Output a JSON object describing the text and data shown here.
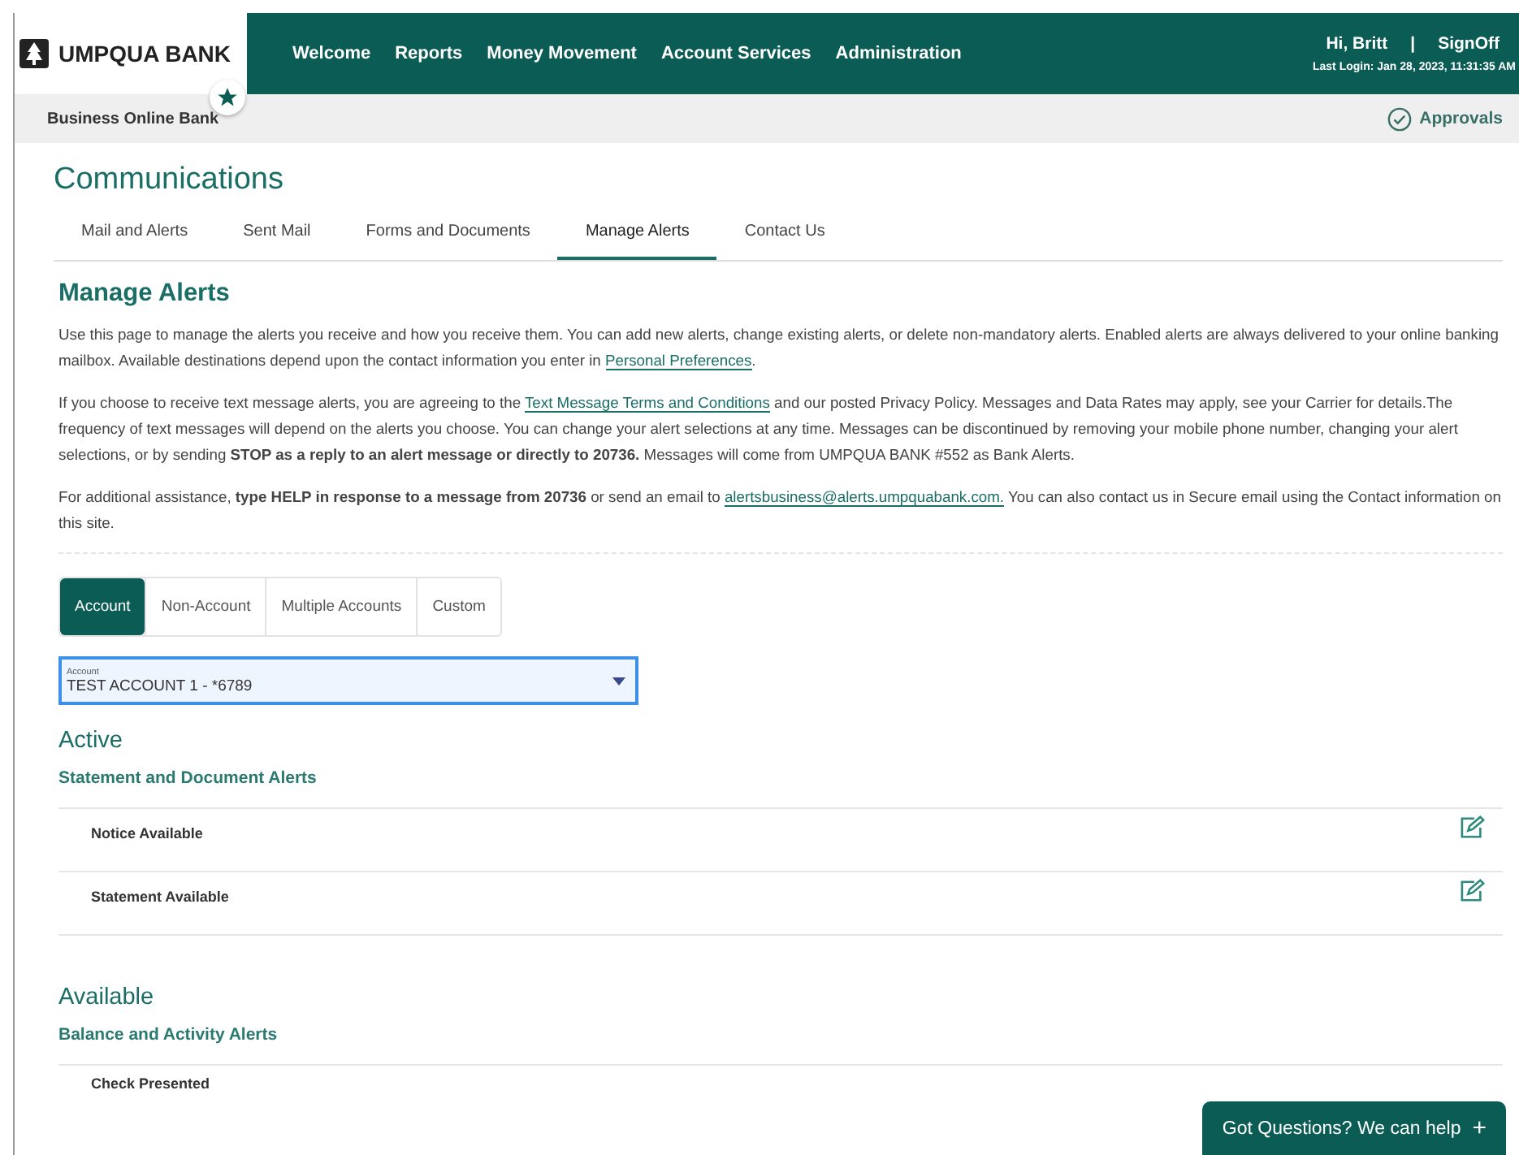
{
  "header": {
    "logo": "UMPQUA BANK",
    "nav": [
      "Welcome",
      "Reports",
      "Money Movement",
      "Account Services",
      "Administration"
    ],
    "greeting": "Hi, Britt",
    "separator": "|",
    "signoff": "SignOff",
    "last_login": "Last Login: Jan 28, 2023, 11:31:35 AM"
  },
  "subheader": {
    "title": "Business Online Bank",
    "approvals": "Approvals"
  },
  "page_title": "Communications",
  "tabs": [
    {
      "label": "Mail and Alerts",
      "selected": false
    },
    {
      "label": "Sent Mail",
      "selected": false
    },
    {
      "label": "Forms and Documents",
      "selected": false
    },
    {
      "label": "Manage Alerts",
      "selected": true
    },
    {
      "label": "Contact Us",
      "selected": false
    }
  ],
  "section_title": "Manage Alerts",
  "paragraphs": [
    [
      {
        "kind": "text",
        "text": "Use this page to manage the alerts you receive and how you receive them. You can add new alerts, change existing alerts, or delete non-mandatory alerts. Enabled alerts are always delivered to your online banking mailbox. Available destinations depend upon the contact information you enter in "
      },
      {
        "kind": "link",
        "text": "Personal Preferences"
      },
      {
        "kind": "text",
        "text": "."
      }
    ],
    [
      {
        "kind": "text",
        "text": "If you choose to receive text message alerts, you are agreeing to the "
      },
      {
        "kind": "link",
        "text": "Text Message Terms and Conditions"
      },
      {
        "kind": "text",
        "text": " and our posted Privacy Policy. Messages and Data Rates may apply, see your Carrier for details.The frequency of text messages will depend on the alerts you choose. You can change your alert selections at any time. Messages can be discontinued by removing your mobile phone number, changing your alert selections, or by sending **STOP as a reply to an alert message or directly to 20736.** Messages will come from UMPQUA BANK #552 as Bank Alerts."
      }
    ],
    [
      {
        "kind": "text",
        "text": "For additional assistance, **type HELP in response to a message from 20736** or send an email to "
      },
      {
        "kind": "link",
        "text": "alertsbusiness@alerts.umpquabank.com."
      },
      {
        "kind": "text",
        "text": " You can also contact us in Secure email using the Contact information on this site."
      }
    ]
  ],
  "alert_types": [
    {
      "label": "Account",
      "selected": true
    },
    {
      "label": "Non-Account",
      "selected": false
    },
    {
      "label": "Multiple Accounts",
      "selected": false
    },
    {
      "label": "Custom",
      "selected": false
    }
  ],
  "account_select": {
    "label": "Account",
    "value": "TEST ACCOUNT 1 - *6789"
  },
  "groups": [
    {
      "title": "Active",
      "subtitle": "Statement and Document Alerts",
      "rows": [
        {
          "label": "Notice Available",
          "editable": true
        },
        {
          "label": "Statement Available",
          "editable": true
        }
      ]
    },
    {
      "title": "Available",
      "subtitle": "Balance and Activity Alerts",
      "rows": [
        {
          "label": "Check Presented",
          "editable": false
        }
      ]
    }
  ],
  "help_button": {
    "label": "Got Questions? We can help",
    "icon": "+"
  }
}
